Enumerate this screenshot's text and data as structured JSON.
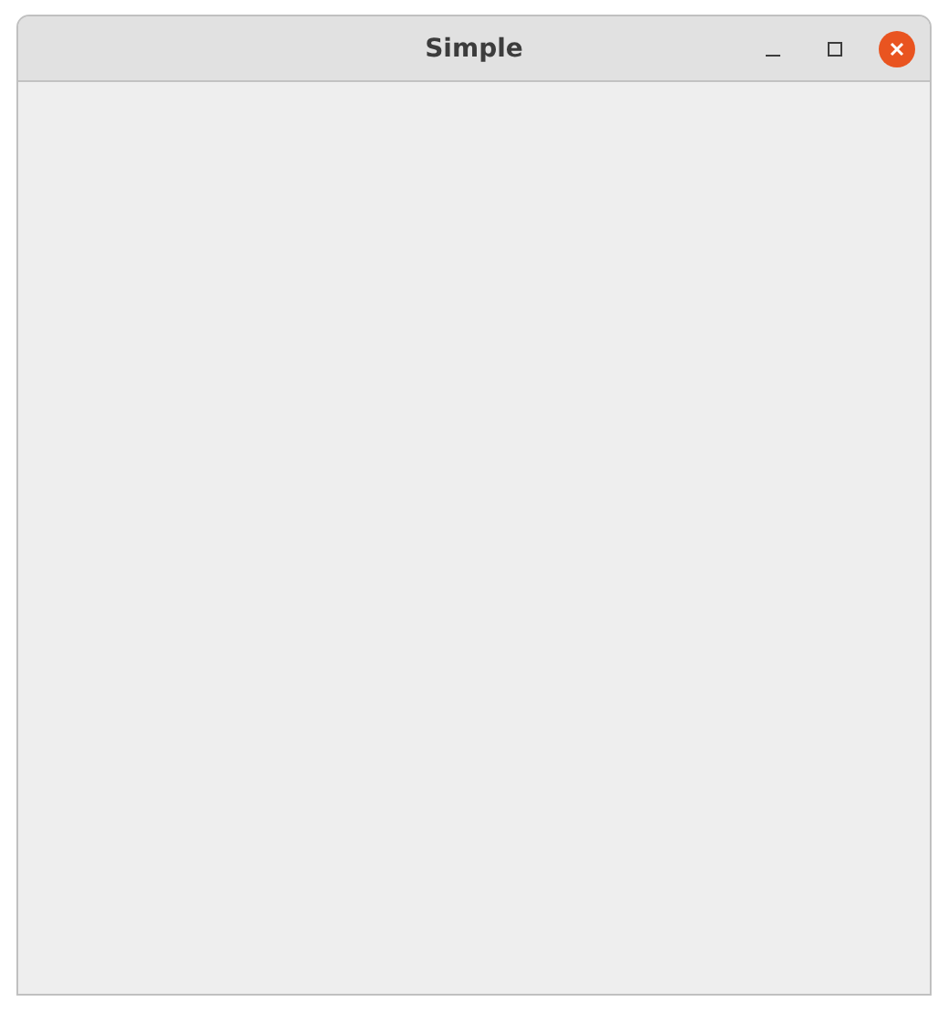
{
  "window": {
    "title": "Simple"
  }
}
